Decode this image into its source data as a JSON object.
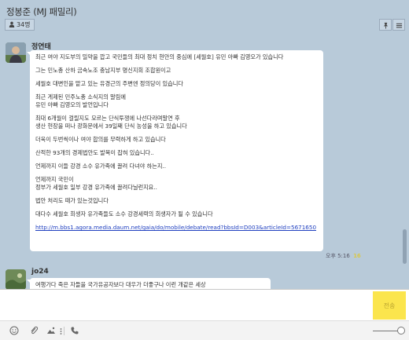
{
  "window": {
    "title": "정봉준 (MJ 패밀리)",
    "member_count": "34명"
  },
  "messages": [
    {
      "sender": "정연태",
      "lines": [
        "최근 여야 지도부의 밀약을 깝고 국민들의 최대 정치 현안의 중심에 [세월호] 유민 아빠 김영오가 있습니다",
        "그는 민노총 산하 금속노조 충남지부 명신지회 조합원이고",
        "세월호 대변인을 맡고 있는 유경근의 주변엔 정의당이 있습니다",
        "최근 게제된 민주노총 소식지의 말림에",
        "유민 아빠 김영오의 발언입니다",
        "최대 6개월이 걸릴지도 모르는 단식투쟁에 나선다라며말연 후",
        "생산 현장을 떠나 광화문에서 39일째 단식 농성을 하고 있습니다",
        "더욱이 두번씩이나 여야 합의를 무력하게 하고 있습니다",
        "산적한 93개의 경제법안도 발목이 잡혀 있습니다..",
        "언제까지 이들 강경 소수 유가족에 끌려 다녀야 하는지..",
        "언제까지 국민이",
        "정부가 세월호 일부 강경 유가족에 끌려다닐런지요..",
        "법안 처리도 때가 있는것입니다",
        "대다수 세월호 희생자 유가족들도 소수 강경세력의 희생자가 될 수 있습니다"
      ],
      "link": "http://m.bbs1.agora.media.daum.net/gaia/do/mobile/debate/read?bbsId=D003&articleId=5671650",
      "time": "오후 5:16",
      "unread": "16"
    },
    {
      "sender": "jo24",
      "text": "여행가다 죽은 자들을 국가유공자보다 대우가 더좋구나 이런 개같은 세상"
    }
  ],
  "input": {
    "value": "",
    "send_label": "전송"
  },
  "colors": {
    "chat_background": "#b8cad9",
    "send_button": "#fbe54d",
    "link": "#2040c0"
  },
  "icons": {
    "header": [
      "person-icon",
      "pin-icon",
      "menu-icon"
    ],
    "toolbar": [
      "emoticon-icon",
      "attachment-icon",
      "photo-icon",
      "menu-icon",
      "call-icon"
    ]
  }
}
